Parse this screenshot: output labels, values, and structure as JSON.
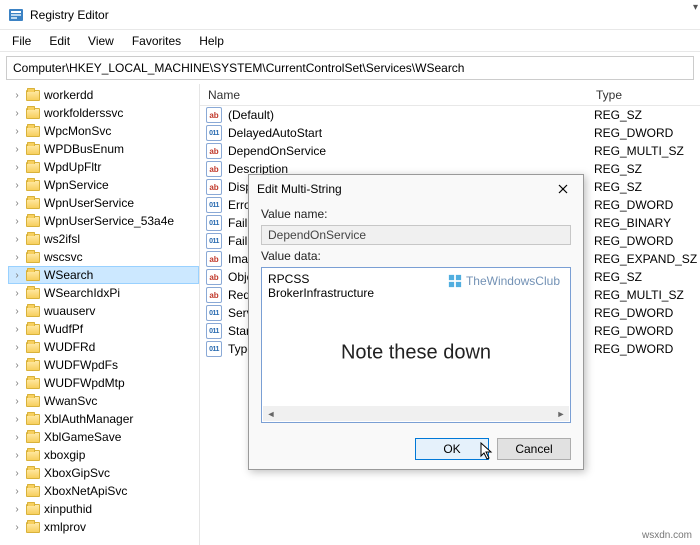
{
  "window": {
    "title": "Registry Editor"
  },
  "menu": {
    "file": "File",
    "edit": "Edit",
    "view": "View",
    "favorites": "Favorites",
    "help": "Help"
  },
  "address": "Computer\\HKEY_LOCAL_MACHINE\\SYSTEM\\CurrentControlSet\\Services\\WSearch",
  "tree": [
    {
      "label": "workerdd",
      "sel": false
    },
    {
      "label": "workfolderssvc",
      "sel": false
    },
    {
      "label": "WpcMonSvc",
      "sel": false
    },
    {
      "label": "WPDBusEnum",
      "sel": false
    },
    {
      "label": "WpdUpFltr",
      "sel": false
    },
    {
      "label": "WpnService",
      "sel": false
    },
    {
      "label": "WpnUserService",
      "sel": false
    },
    {
      "label": "WpnUserService_53a4e",
      "sel": false
    },
    {
      "label": "ws2ifsl",
      "sel": false
    },
    {
      "label": "wscsvc",
      "sel": false
    },
    {
      "label": "WSearch",
      "sel": true
    },
    {
      "label": "WSearchIdxPi",
      "sel": false
    },
    {
      "label": "wuauserv",
      "sel": false
    },
    {
      "label": "WudfPf",
      "sel": false
    },
    {
      "label": "WUDFRd",
      "sel": false
    },
    {
      "label": "WUDFWpdFs",
      "sel": false
    },
    {
      "label": "WUDFWpdMtp",
      "sel": false
    },
    {
      "label": "WwanSvc",
      "sel": false
    },
    {
      "label": "XblAuthManager",
      "sel": false
    },
    {
      "label": "XblGameSave",
      "sel": false
    },
    {
      "label": "xboxgip",
      "sel": false
    },
    {
      "label": "XboxGipSvc",
      "sel": false
    },
    {
      "label": "XboxNetApiSvc",
      "sel": false
    },
    {
      "label": "xinputhid",
      "sel": false
    },
    {
      "label": "xmlprov",
      "sel": false
    }
  ],
  "list": {
    "col_name": "Name",
    "col_type": "Type",
    "rows": [
      {
        "icon": "ab",
        "name": "(Default)",
        "type": "REG_SZ"
      },
      {
        "icon": "011",
        "name": "DelayedAutoStart",
        "type": "REG_DWORD"
      },
      {
        "icon": "ab",
        "name": "DependOnService",
        "type": "REG_MULTI_SZ"
      },
      {
        "icon": "ab",
        "name": "Description",
        "type": "REG_SZ"
      },
      {
        "icon": "ab",
        "name": "Disp",
        "type": "REG_SZ"
      },
      {
        "icon": "011",
        "name": "Error",
        "type": "REG_DWORD"
      },
      {
        "icon": "011",
        "name": "Failu",
        "type": "REG_BINARY"
      },
      {
        "icon": "011",
        "name": "Failu",
        "type": "REG_DWORD"
      },
      {
        "icon": "ab",
        "name": "Imag",
        "type": "REG_EXPAND_SZ"
      },
      {
        "icon": "ab",
        "name": "Obje",
        "type": "REG_SZ"
      },
      {
        "icon": "ab",
        "name": "Requ",
        "type": "REG_MULTI_SZ"
      },
      {
        "icon": "011",
        "name": "Servi",
        "type": "REG_DWORD"
      },
      {
        "icon": "011",
        "name": "Start",
        "type": "REG_DWORD"
      },
      {
        "icon": "011",
        "name": "Type",
        "type": "REG_DWORD"
      }
    ]
  },
  "dialog": {
    "title": "Edit Multi-String",
    "valname_label": "Value name:",
    "valname_value": "DependOnService",
    "valdata_label": "Value data:",
    "valdata_value": "RPCSS\nBrokerInfrastructure",
    "watermark": "TheWindowsClub",
    "annotation": "Note these down",
    "ok": "OK",
    "cancel": "Cancel"
  },
  "footer_watermark": "wsxdn.com"
}
